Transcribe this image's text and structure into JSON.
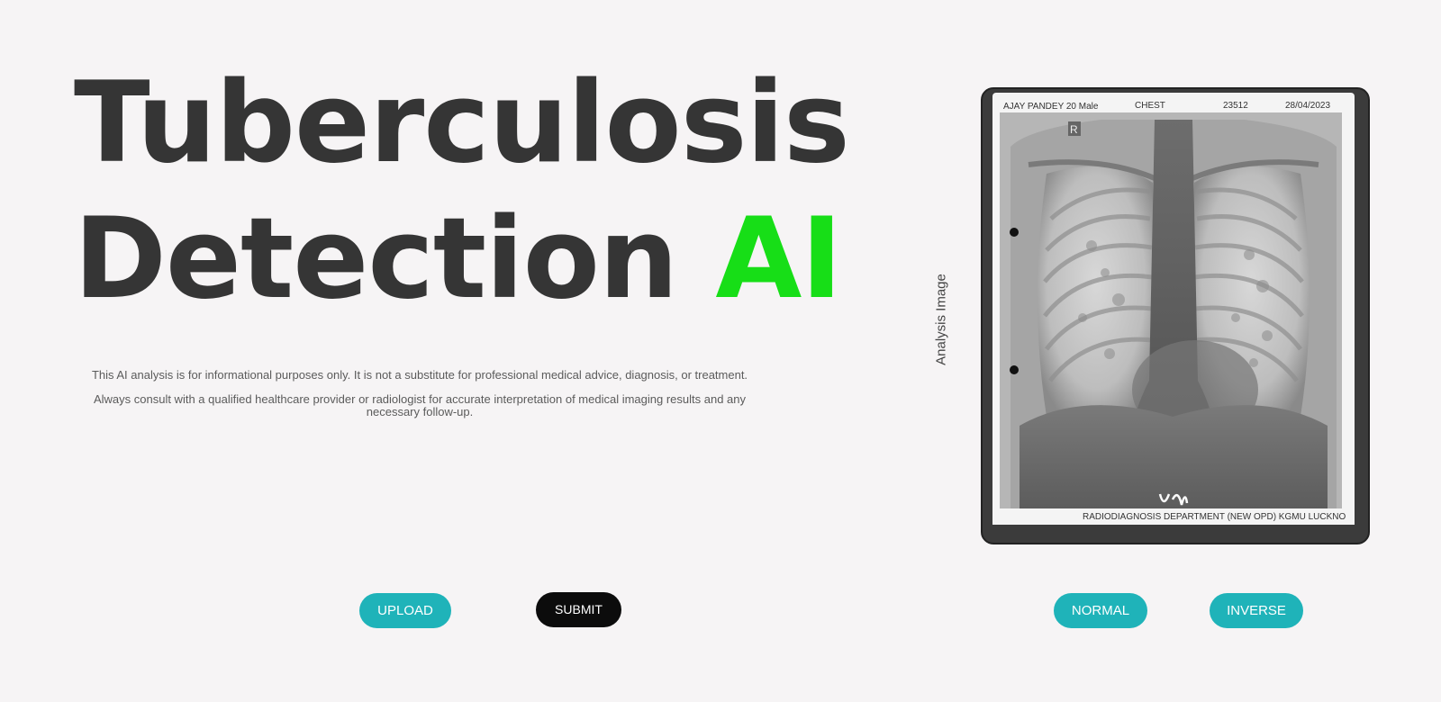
{
  "hero": {
    "title_line1": "Tuberculosis",
    "title_line2_main": "Detection",
    "title_line2_accent": "AI"
  },
  "disclaimer": {
    "line1": "This AI analysis is for informational purposes only. It is not a substitute for professional medical advice, diagnosis, or treatment.",
    "line2": "Always consult with a qualified healthcare provider or radiologist for accurate interpretation of medical imaging results and any necessary follow-up."
  },
  "buttons": {
    "upload": "UPLOAD",
    "submit": "SUBMIT",
    "normal": "NORMAL",
    "inverse": "INVERSE"
  },
  "analysis": {
    "label": "Analysis Image",
    "xray": {
      "patient": "AJAY PANDEY 20 Male",
      "region": "CHEST",
      "id": "23512",
      "date": "28/04/2023",
      "marker": "R",
      "department": "RADIODIAGNOSIS DEPARTMENT (NEW OPD) KGMU LUCKNO"
    }
  },
  "colors": {
    "background": "#f6f4f5",
    "title": "#353535",
    "accent": "#17de17",
    "teal_button": "#1fb3b9",
    "dark_button": "#0c0c0c"
  }
}
